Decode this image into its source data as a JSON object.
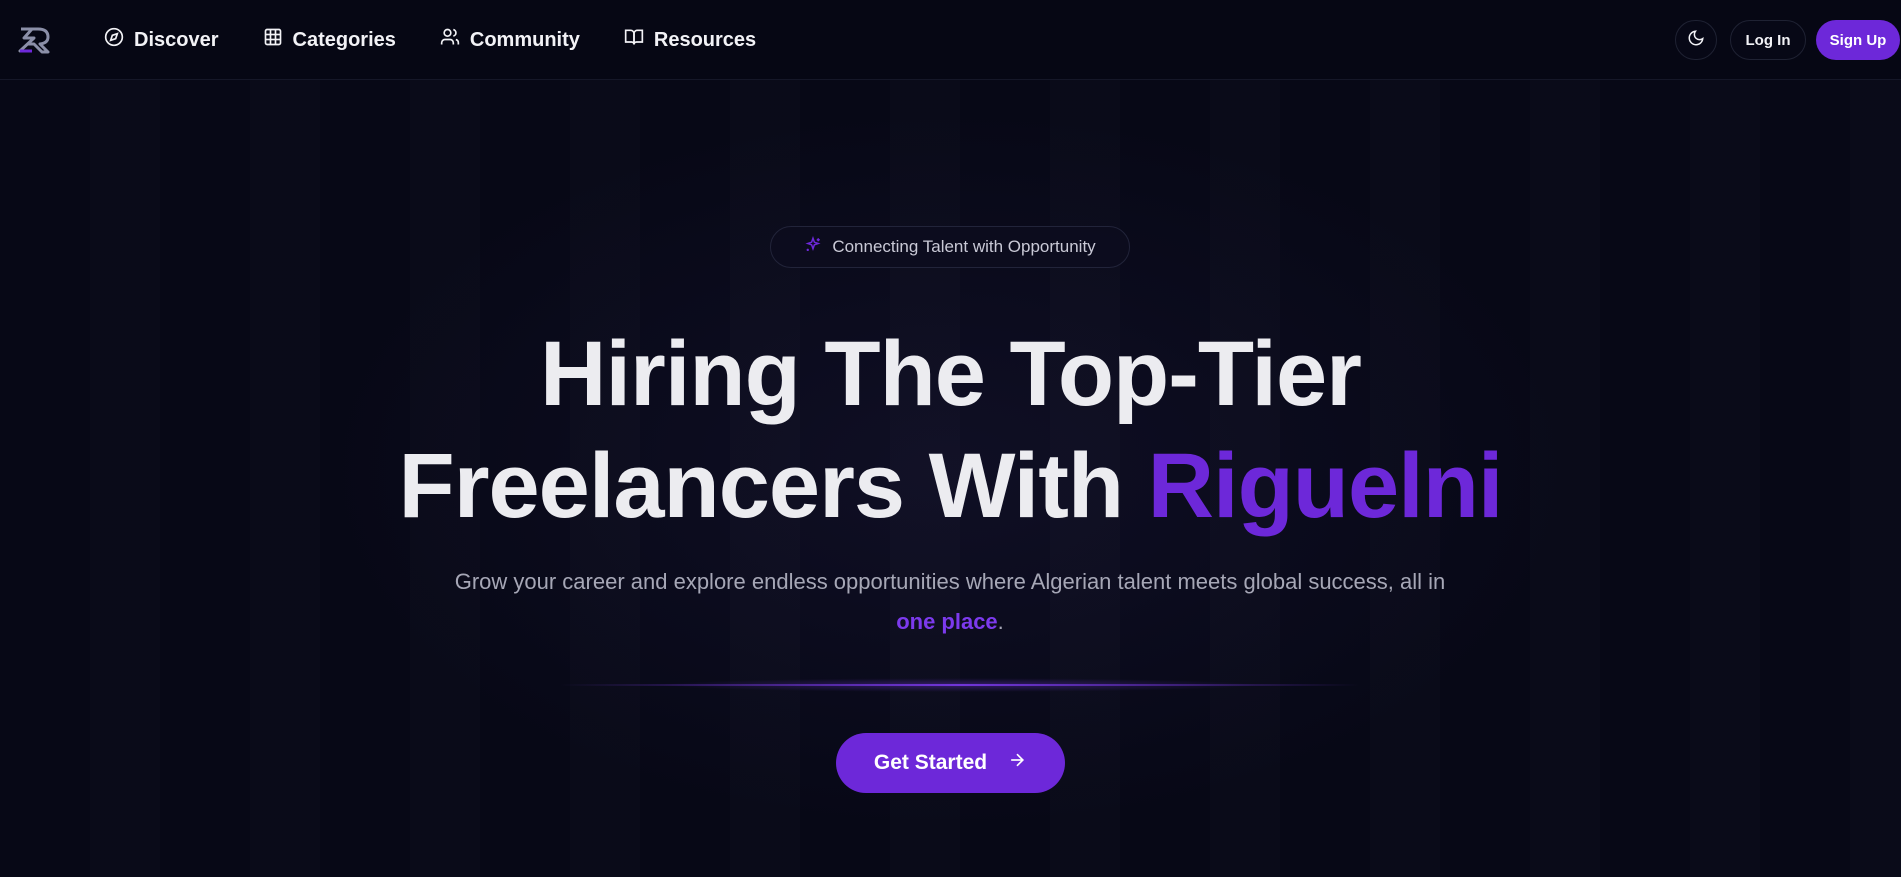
{
  "colors": {
    "background": "#070816",
    "accent": "#6d28d9",
    "text": "#ececf0",
    "muted": "#a6a7b6"
  },
  "nav": {
    "logo_icon": "riguelni-logo",
    "links": [
      {
        "label": "Discover",
        "icon": "compass-icon"
      },
      {
        "label": "Categories",
        "icon": "grid-icon"
      },
      {
        "label": "Community",
        "icon": "users-icon"
      },
      {
        "label": "Resources",
        "icon": "book-icon"
      }
    ],
    "theme_toggle_icon": "moon-icon",
    "login_label": "Log In",
    "signup_label": "Sign Up"
  },
  "hero": {
    "badge_icon": "sparkles-icon",
    "badge_text": "Connecting Talent with Opportunity",
    "headline_line1": "Hiring The Top-Tier",
    "headline_line2_prefix": "Freelancers With ",
    "headline_accent": "Riguelni",
    "subtitle_prefix": "Grow your career and explore endless opportunities where Algerian talent meets global success, all in ",
    "subtitle_accent": "one place",
    "subtitle_suffix": ".",
    "cta_label": "Get Started",
    "cta_icon": "arrow-right-icon"
  }
}
